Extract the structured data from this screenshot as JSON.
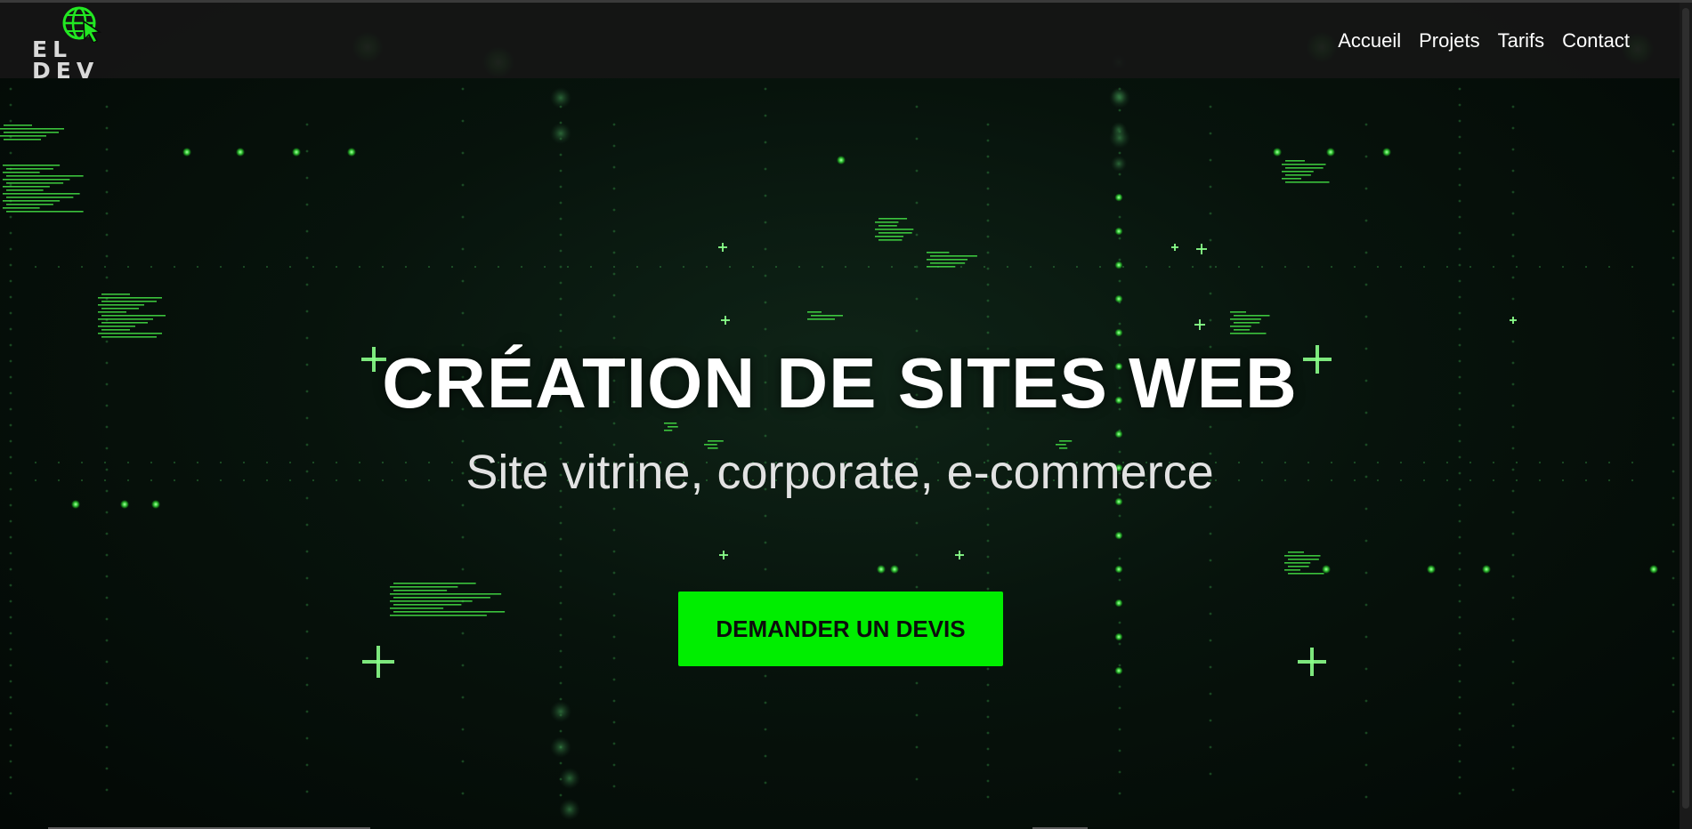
{
  "brand": {
    "logo_text": "EL DEV",
    "logo_icon": "globe-cursor-icon",
    "accent_color": "#00ee00"
  },
  "nav": {
    "items": [
      {
        "label": "Accueil"
      },
      {
        "label": "Projets"
      },
      {
        "label": "Tarifs"
      },
      {
        "label": "Contact"
      }
    ]
  },
  "hero": {
    "title": "CRÉATION DE SITES WEB",
    "subtitle": "Site vitrine, corporate, e-commerce",
    "cta_label": "DEMANDER UN DEVIS",
    "cta_color": "#00ee00"
  },
  "theme": {
    "background": "#050a07",
    "navbar_background": "#161616",
    "glow_color": "#5cff5c"
  }
}
